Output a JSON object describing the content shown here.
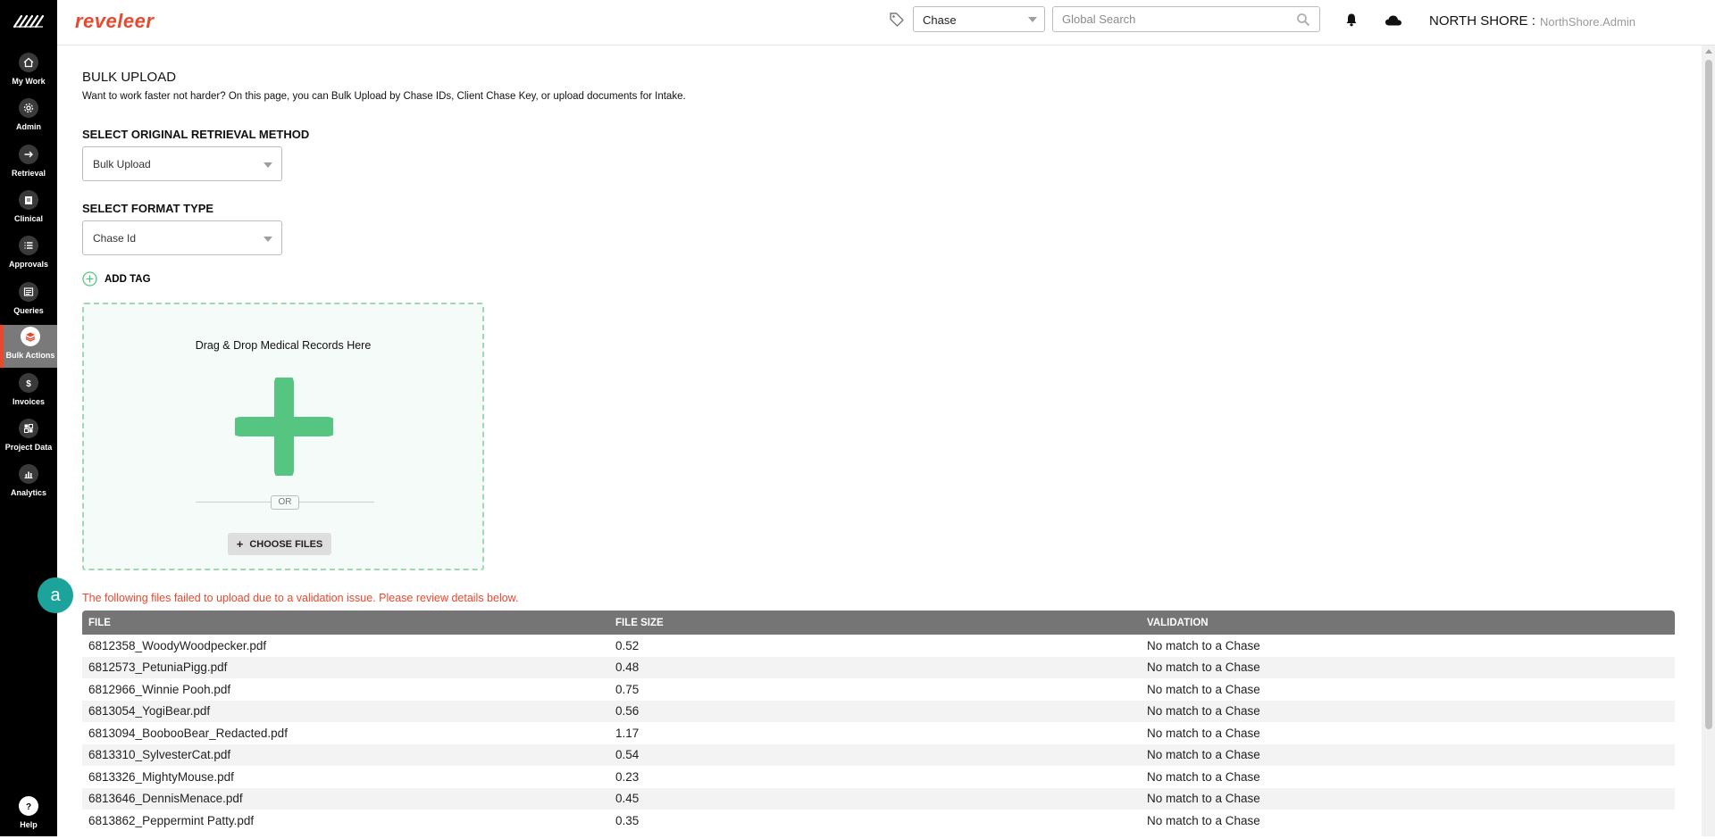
{
  "header": {
    "brand": "reveleer",
    "entity_select": "Chase",
    "search_placeholder": "Global Search",
    "org": "NORTH SHORE :",
    "user": "NorthShore.Admin"
  },
  "sidebar": {
    "items": [
      {
        "label": "My Work",
        "icon": "home-icon"
      },
      {
        "label": "Admin",
        "icon": "admin-gear-icon"
      },
      {
        "label": "Retrieval",
        "icon": "arrow-right-icon"
      },
      {
        "label": "Clinical",
        "icon": "clipboard-icon"
      },
      {
        "label": "Approvals",
        "icon": "list-icon"
      },
      {
        "label": "Queries",
        "icon": "document-icon"
      },
      {
        "label": "Bulk Actions",
        "icon": "layers-icon"
      },
      {
        "label": "Invoices",
        "icon": "dollar-icon"
      },
      {
        "label": "Project Data",
        "icon": "grid-icon"
      },
      {
        "label": "Analytics",
        "icon": "bar-chart-icon"
      }
    ],
    "help": "Help"
  },
  "main": {
    "title": "BULK UPLOAD",
    "description": "Want to work faster not harder? On this page, you can Bulk Upload by Chase IDs, Client Chase Key, or upload documents for Intake.",
    "retrieval_label": "SELECT ORIGINAL RETRIEVAL METHOD",
    "retrieval_value": "Bulk Upload",
    "format_label": "SELECT FORMAT TYPE",
    "format_value": "Chase Id",
    "add_tag": "ADD TAG",
    "dropzone_title": "Drag & Drop Medical Records Here",
    "or": "OR",
    "choose_files": "CHOOSE FILES",
    "error_message": "The following files failed to upload due to a validation issue. Please review details below.",
    "badge": "a"
  },
  "table": {
    "headers": [
      "FILE",
      "FILE SIZE",
      "VALIDATION"
    ],
    "rows": [
      [
        "6812358_WoodyWoodpecker.pdf",
        "0.52",
        "No match to a Chase"
      ],
      [
        "6812573_PetuniaPigg.pdf",
        "0.48",
        "No match to a Chase"
      ],
      [
        "6812966_Winnie Pooh.pdf",
        "0.75",
        "No match to a Chase"
      ],
      [
        "6813054_YogiBear.pdf",
        "0.56",
        "No match to a Chase"
      ],
      [
        "6813094_BoobooBear_Redacted.pdf",
        "1.17",
        "No match to a Chase"
      ],
      [
        "6813310_SylvesterCat.pdf",
        "0.54",
        "No match to a Chase"
      ],
      [
        "6813326_MightyMouse.pdf",
        "0.23",
        "No match to a Chase"
      ],
      [
        "6813646_DennisMenace.pdf",
        "0.45",
        "No match to a Chase"
      ],
      [
        "6813862_Peppermint Patty.pdf",
        "0.35",
        "No match to a Chase"
      ]
    ]
  },
  "colors": {
    "brand": "#e8492e",
    "accent_green": "#57c582",
    "error": "#e8492e",
    "badge": "#1ba39c"
  }
}
